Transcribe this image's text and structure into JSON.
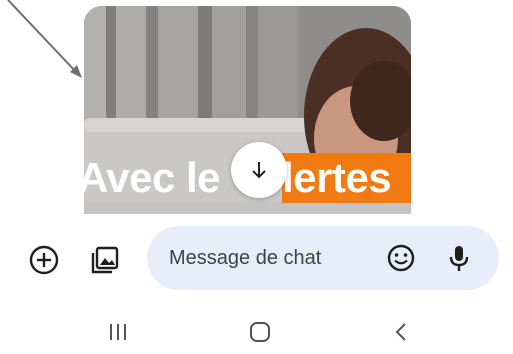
{
  "media": {
    "banner_left_text": "Avec le",
    "banner_right_text": "lertes",
    "colors": {
      "banner_orange": "#f27a12",
      "banner_text": "#ffffff"
    }
  },
  "scroll_down_button": {
    "icon": "arrow-down-icon"
  },
  "composer": {
    "add_icon": "add-circle-icon",
    "gallery_icon": "gallery-icon",
    "message_placeholder": "Message de chat",
    "emoji_icon": "emoji-icon",
    "mic_icon": "microphone-icon",
    "field_color": "#e8eef9"
  },
  "nav_bar": {
    "recents_icon": "recents-icon",
    "home_icon": "home-icon",
    "back_icon": "back-icon"
  }
}
